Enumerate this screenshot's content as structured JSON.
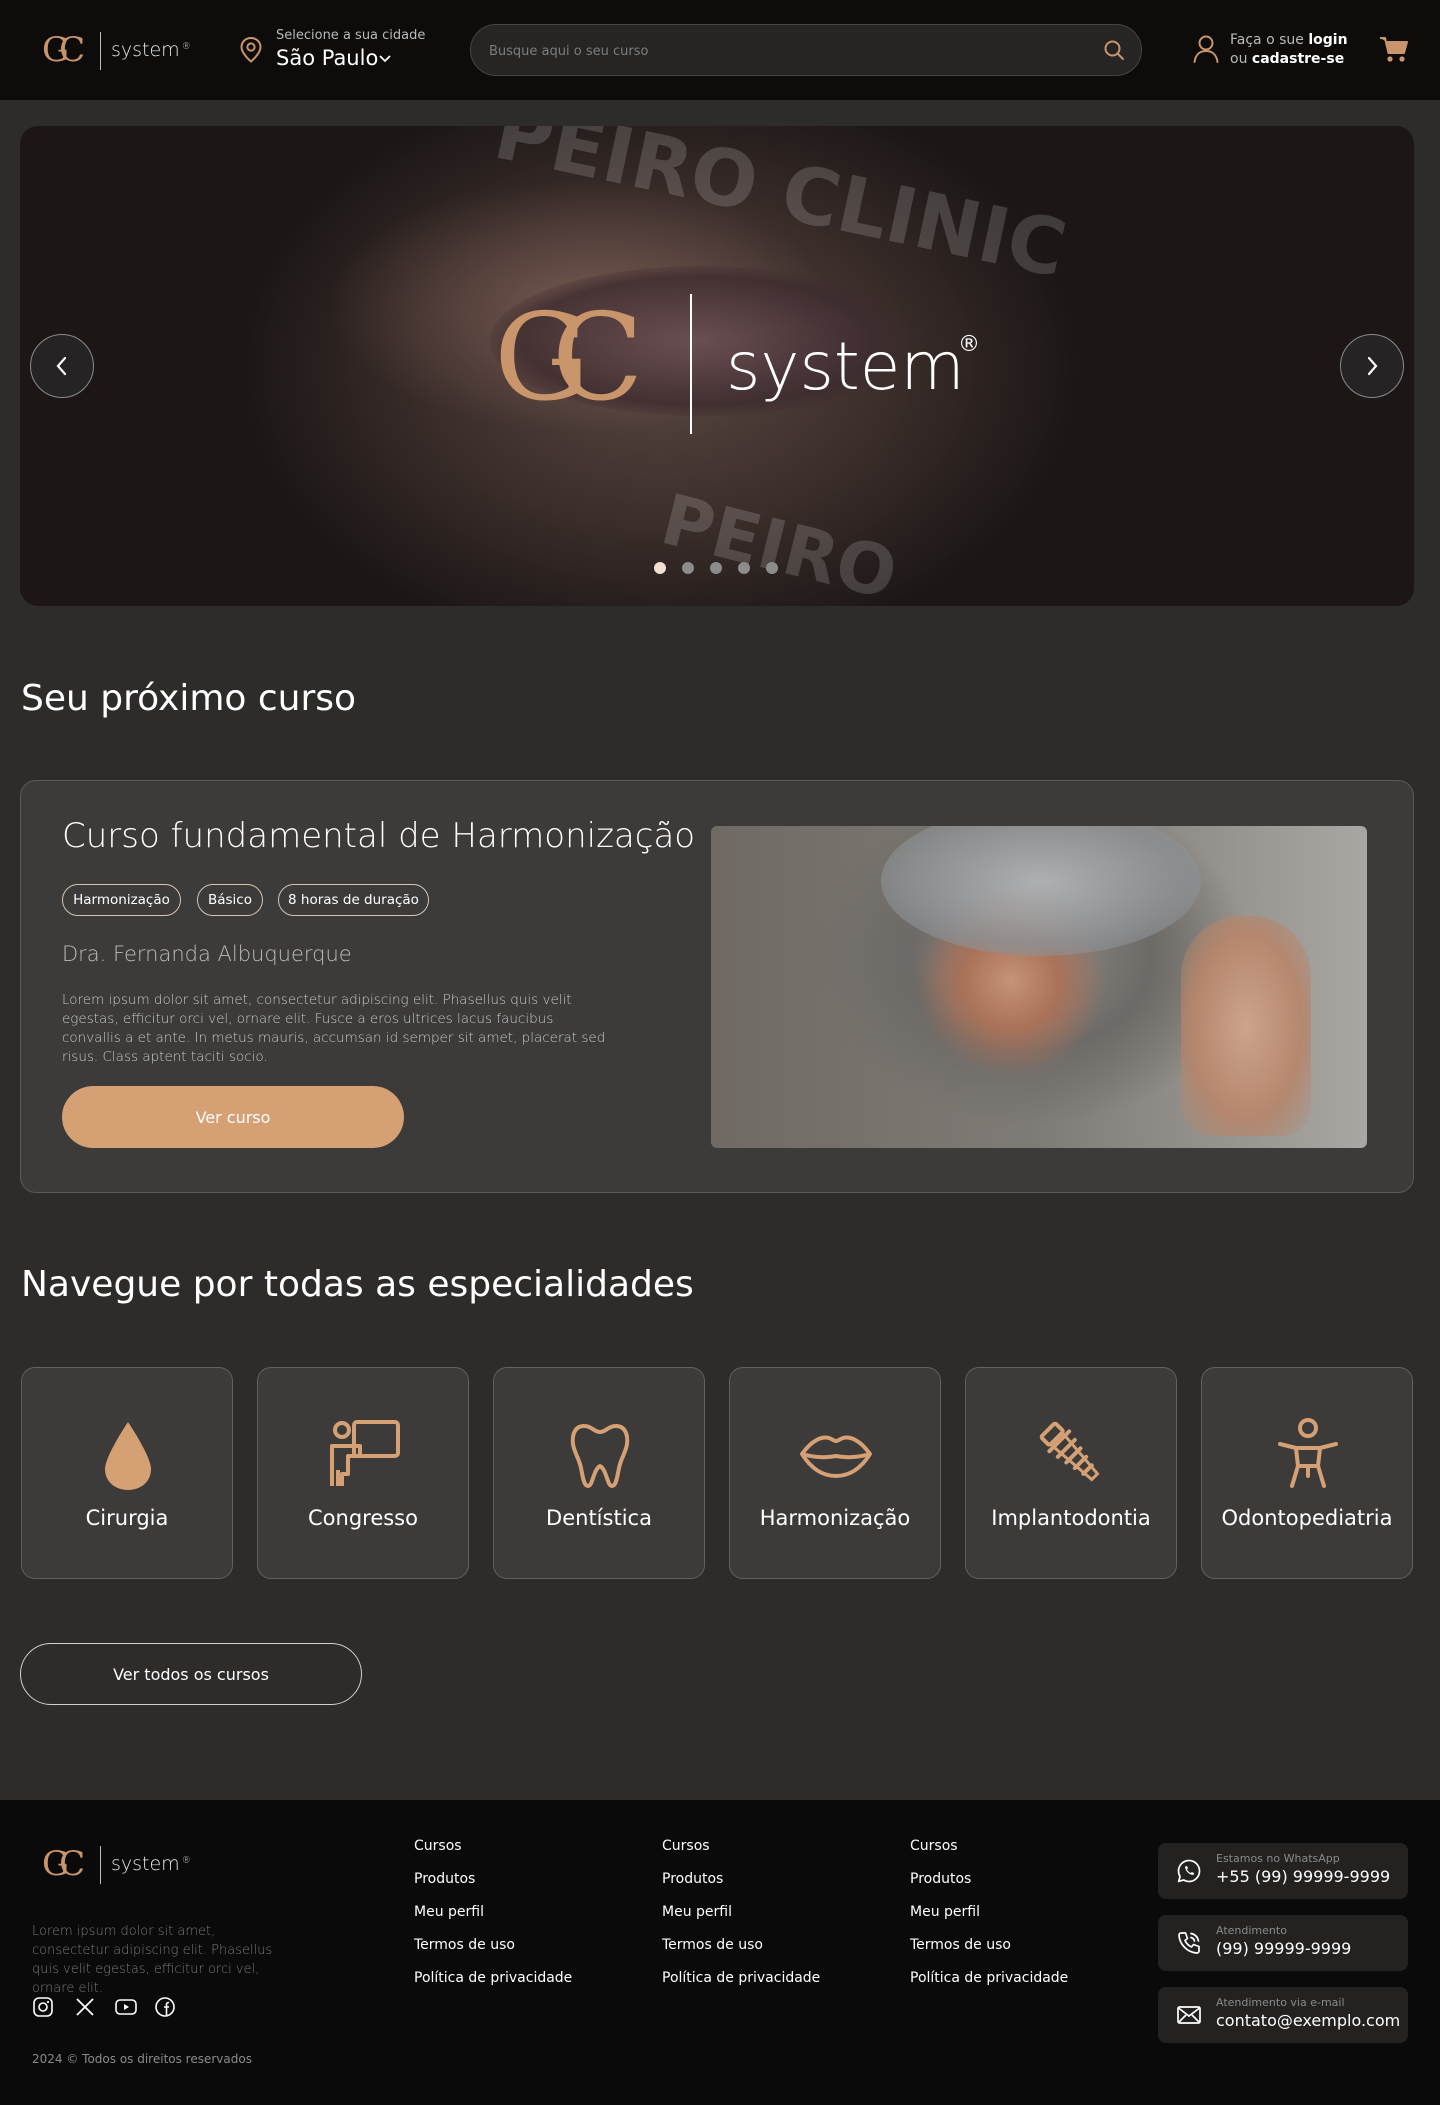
{
  "header": {
    "logo": {
      "mark": "GC",
      "word": "system",
      "reg": "®"
    },
    "city": {
      "label": "Selecione a sua cidade",
      "value": "São Paulo"
    },
    "search": {
      "placeholder": "Busque aqui o seu curso"
    },
    "account": {
      "prefix": "Faça o sue",
      "login": "login",
      "or": "ou",
      "signup": "cadastre-se"
    }
  },
  "hero": {
    "logo_mark": "GC",
    "logo_word": "system",
    "logo_reg": "®",
    "watermark_top": "PEIRO  CLINIC",
    "watermark_bottom": "PEIRO",
    "slides_total": 5,
    "active_slide": 1
  },
  "next_course": {
    "section_title": "Seu próximo curso",
    "title": "Curso fundamental de Harmonização",
    "tags": [
      "Harmonização",
      "Básico",
      "8 horas de duração"
    ],
    "instructor": "Dra. Fernanda Albuquerque",
    "description": "Lorem ipsum dolor sit amet, consectetur adipiscing elit. Phasellus quis velit egestas, efficitur orci vel, ornare elit. Fusce a eros ultrices lacus faucibus convallis a et ante. In metus mauris, accumsan id semper sit amet, placerat sed risus. Class aptent taciti socio.",
    "cta": "Ver curso"
  },
  "specialties": {
    "section_title": "Navegue por todas as especialidades",
    "items": [
      {
        "label": "Cirurgia",
        "icon": "drop-icon"
      },
      {
        "label": "Congresso",
        "icon": "presenter-board-icon"
      },
      {
        "label": "Dentística",
        "icon": "tooth-icon"
      },
      {
        "label": "Harmonização",
        "icon": "lips-icon"
      },
      {
        "label": "Implantodontia",
        "icon": "dental-implant-icon"
      },
      {
        "label": "Odontopediatria",
        "icon": "child-icon"
      }
    ],
    "cta": "Ver todos os cursos"
  },
  "footer": {
    "logo": {
      "mark": "GC",
      "word": "system",
      "reg": "®"
    },
    "description": "Lorem ipsum dolor sit amet, consectetur adipiscing elit. Phasellus quis velit egestas, efficitur orci vel, ornare elit.",
    "social": [
      "instagram-icon",
      "x-icon",
      "youtube-icon",
      "facebook-icon"
    ],
    "columns": [
      [
        "Cursos",
        "Produtos",
        "Meu perfil",
        "Termos de uso",
        "Política de privacidade"
      ],
      [
        "Cursos",
        "Produtos",
        "Meu perfil",
        "Termos de uso",
        "Política de privacidade"
      ],
      [
        "Cursos",
        "Produtos",
        "Meu perfil",
        "Termos de uso",
        "Política de privacidade"
      ]
    ],
    "contacts": [
      {
        "label": "Estamos no WhatsApp",
        "value": "+55 (99) 99999-9999",
        "icon": "whatsapp-icon"
      },
      {
        "label": "Atendimento",
        "value": "(99) 99999-9999",
        "icon": "phone-icon"
      },
      {
        "label": "Atendimento via e-mail",
        "value": "contato@exemplo.com",
        "icon": "mail-icon"
      }
    ],
    "copyright": "2024 © Todos os direitos reservados"
  },
  "colors": {
    "accent": "#d4a074",
    "background": "#2d2c2b",
    "card": "#3c3b3a",
    "header": "#0d0c0b"
  }
}
